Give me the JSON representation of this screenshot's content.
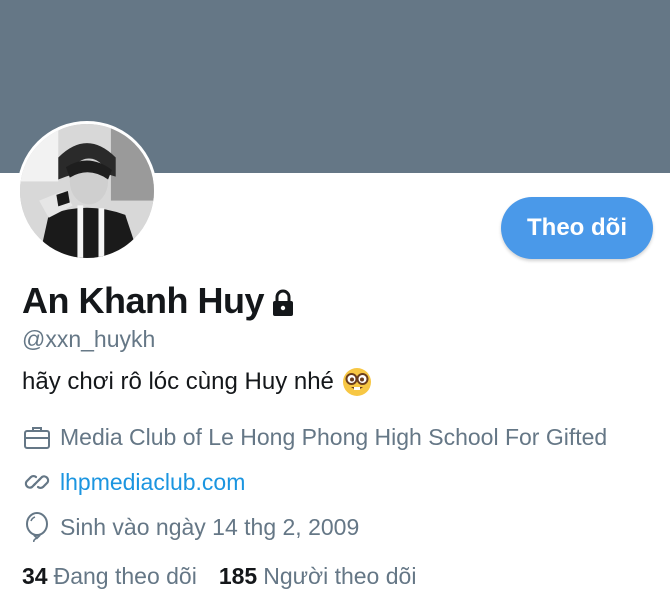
{
  "colors": {
    "banner": "#657786",
    "accent": "#4a99e9",
    "link": "#1b95e0",
    "secondary_text": "#657786",
    "primary_text": "#14171a"
  },
  "profile": {
    "display_name": "An Khanh Huy",
    "protected_icon": "lock-icon",
    "handle": "@xxn_huykh",
    "bio": "hãy chơi rô lóc cùng Huy nhé",
    "bio_emoji": "nerd-face-emoji",
    "avatar_icon": "profile-photo"
  },
  "actions": {
    "follow_label": "Theo dõi"
  },
  "details": {
    "work": {
      "icon": "briefcase-icon",
      "text": "Media Club of Le Hong Phong High School For Gifted"
    },
    "website": {
      "icon": "link-icon",
      "text": "lhpmediaclub.com"
    },
    "birthday": {
      "icon": "balloon-icon",
      "text": "Sinh vào ngày 14 thg 2, 2009"
    }
  },
  "stats": {
    "following_count": "34",
    "following_label": "Đang theo dõi",
    "followers_count": "185",
    "followers_label": "Người theo dõi"
  }
}
